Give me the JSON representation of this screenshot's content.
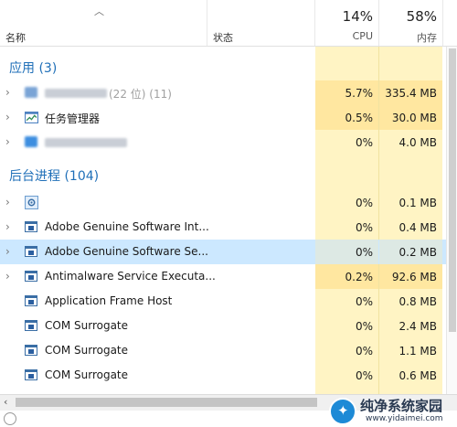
{
  "header": {
    "sort_icon": "chevron-up-icon",
    "col_name": "名称",
    "col_status": "状态",
    "cpu_percent": "14%",
    "cpu_label": "CPU",
    "mem_percent": "58%",
    "mem_label": "内存"
  },
  "sections": {
    "apps_title": "应用 (3)",
    "bg_title": "后台进程 (104)"
  },
  "apps": [
    {
      "name": "(22 位) (11)",
      "name_blurred": true,
      "cpu": "5.7%",
      "mem": "335.4 MB",
      "icon": "blurred-app-icon"
    },
    {
      "name": "任务管理器",
      "name_blurred": false,
      "cpu": "0.5%",
      "mem": "30.0 MB",
      "icon": "task-manager-icon"
    },
    {
      "name": "",
      "name_blurred": true,
      "cpu": "0%",
      "mem": "4.0 MB",
      "icon": "blurred-app-icon"
    }
  ],
  "processes": [
    {
      "name": "",
      "cpu": "0%",
      "mem": "0.1 MB",
      "icon": "gear-icon",
      "expandable": true
    },
    {
      "name": "Adobe Genuine Software Int...",
      "cpu": "0%",
      "mem": "0.4 MB",
      "icon": "app-window-icon",
      "expandable": true
    },
    {
      "name": "Adobe Genuine Software Se...",
      "cpu": "0%",
      "mem": "0.2 MB",
      "icon": "app-window-icon",
      "expandable": true,
      "selected": true
    },
    {
      "name": "Antimalware Service Executa...",
      "cpu": "0.2%",
      "mem": "92.6 MB",
      "icon": "app-window-icon",
      "expandable": true
    },
    {
      "name": "Application Frame Host",
      "cpu": "0%",
      "mem": "0.8 MB",
      "icon": "app-window-icon",
      "expandable": false
    },
    {
      "name": "COM Surrogate",
      "cpu": "0%",
      "mem": "2.4 MB",
      "icon": "app-window-icon",
      "expandable": false
    },
    {
      "name": "COM Surrogate",
      "cpu": "0%",
      "mem": "1.1 MB",
      "icon": "app-window-icon",
      "expandable": false
    },
    {
      "name": "COM Surrogate",
      "cpu": "0%",
      "mem": "0.6 MB",
      "icon": "app-window-icon",
      "expandable": false
    }
  ],
  "watermark": {
    "text": "纯净系统家园",
    "url": "www.yidaimei.com"
  },
  "colors": {
    "accent": "#1f6fb8",
    "heat_light": "#fff4c4",
    "heat_strong": "#ffe7a0",
    "selected_row": "#cce8ff"
  }
}
